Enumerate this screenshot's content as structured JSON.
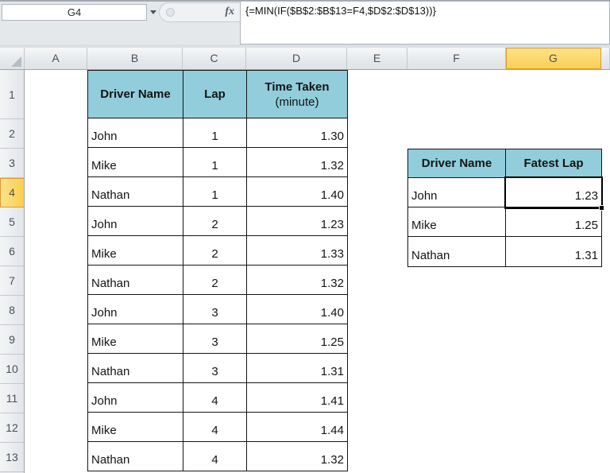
{
  "name_box": {
    "value": "G4"
  },
  "formula_bar": {
    "fx": "fx",
    "formula": "{=MIN(IF($B$2:$B$13=F4,$D$2:$D$13))}"
  },
  "sheet": {
    "columns": [
      "A",
      "B",
      "C",
      "D",
      "E",
      "F",
      "G"
    ],
    "rows": [
      "1",
      "2",
      "3",
      "4",
      "5",
      "6",
      "7",
      "8",
      "9",
      "10",
      "11",
      "12",
      "13"
    ],
    "selected_cell": "G4",
    "selected_column": "G",
    "selected_row": "4"
  },
  "colors": {
    "table_header_fill": "#92CDDC",
    "selected_header_fill": "#F9CF4F",
    "selected_header_border": "#DD9933",
    "selection_border": "#000000",
    "header_text": "#474F5D"
  },
  "lap_table": {
    "headers": {
      "driver": "Driver Name",
      "lap": "Lap",
      "time_line1": "Time Taken",
      "time_line2": "(minute)"
    },
    "rows": [
      [
        "John",
        "1",
        "1.30"
      ],
      [
        "Mike",
        "1",
        "1.32"
      ],
      [
        "Nathan",
        "1",
        "1.40"
      ],
      [
        "John",
        "2",
        "1.23"
      ],
      [
        "Mike",
        "2",
        "1.33"
      ],
      [
        "Nathan",
        "2",
        "1.32"
      ],
      [
        "John",
        "3",
        "1.40"
      ],
      [
        "Mike",
        "3",
        "1.25"
      ],
      [
        "Nathan",
        "3",
        "1.31"
      ],
      [
        "John",
        "4",
        "1.41"
      ],
      [
        "Mike",
        "4",
        "1.44"
      ],
      [
        "Nathan",
        "4",
        "1.32"
      ]
    ]
  },
  "result_table": {
    "headers": {
      "driver": "Driver Name",
      "fastest": "Fatest Lap"
    },
    "rows": [
      [
        "John",
        "1.23"
      ],
      [
        "Mike",
        "1.25"
      ],
      [
        "Nathan",
        "1.31"
      ]
    ]
  }
}
